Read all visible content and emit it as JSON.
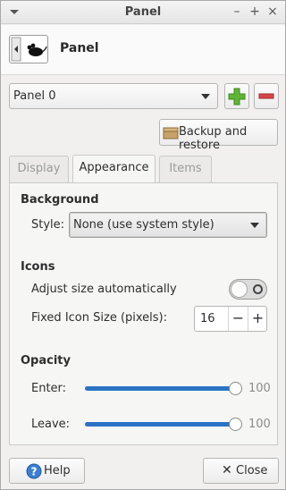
{
  "window": {
    "title": "Panel"
  },
  "header": {
    "title": "Panel"
  },
  "panel_select": {
    "selected": "Panel 0"
  },
  "buttons": {
    "backup_restore": "Backup and restore",
    "help": "Help",
    "close": "Close"
  },
  "tabs": [
    {
      "label": "Display",
      "active": false
    },
    {
      "label": "Appearance",
      "active": true
    },
    {
      "label": "Items",
      "active": false
    }
  ],
  "background": {
    "heading": "Background",
    "style_label": "Style:",
    "style_value": "None (use system style)"
  },
  "icons": {
    "heading": "Icons",
    "adjust_label": "Adjust size automatically",
    "adjust_enabled": false,
    "fixed_size_label": "Fixed Icon Size (pixels):",
    "fixed_size_value": "16"
  },
  "opacity": {
    "heading": "Opacity",
    "enter_label": "Enter:",
    "enter_value": "100",
    "leave_label": "Leave:",
    "leave_value": "100"
  },
  "colors": {
    "accent": "#2b73c4",
    "add_green": "#5fb435",
    "remove_red": "#d64545"
  }
}
